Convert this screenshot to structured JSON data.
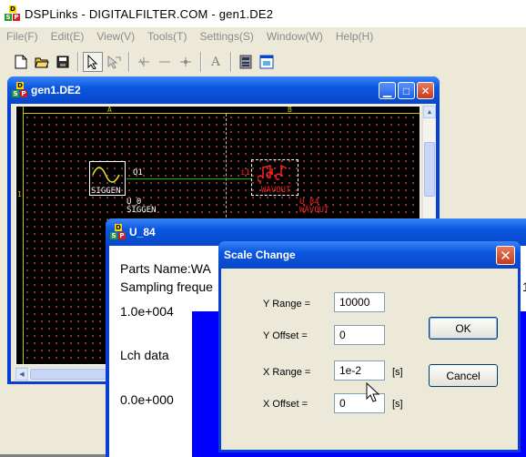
{
  "app": {
    "title": "DSPLinks - DIGITALFILTER.COM - gen1.DE2",
    "logo": {
      "d": "D",
      "s": "S",
      "p": "P"
    }
  },
  "menu": [
    "File(F)",
    "Edit(E)",
    "View(V)",
    "Tools(T)",
    "Settings(S)",
    "Window(W)",
    "Help(H)"
  ],
  "toolbar": {
    "buttons": [
      "new-file",
      "open-folder",
      "save",
      "select-arrow",
      "wire-tool",
      "component-tool",
      "line-tool",
      "junction-tool",
      "text-tool",
      "monitor",
      "window"
    ],
    "text_tool_glyph": "A"
  },
  "gen_window": {
    "title": "gen1.DE2",
    "columns": [
      "A",
      "B"
    ],
    "rows": [
      "1"
    ],
    "siggen": {
      "port": "O1",
      "name": "SIGGEN",
      "instance": "U_0",
      "type": "SIGGEN"
    },
    "wavout": {
      "port": "i1",
      "name": "WAVOUT",
      "instance": "U_84",
      "type": "WAVOUT"
    }
  },
  "u84_window": {
    "title": "U_84",
    "parts_name": "Parts Name:WA",
    "sampling": "Sampling freque",
    "y_max": "1.0e+004",
    "channel": "Lch data",
    "y_min": "0.0e+000",
    "right_fragment": "1"
  },
  "dialog": {
    "title": "Scale Change",
    "close_glyph": "✕",
    "fields": [
      {
        "label": "Y Range =",
        "value": "10000",
        "unit": ""
      },
      {
        "label": "Y Offset =",
        "value": "0",
        "unit": ""
      },
      {
        "label": "X Range =",
        "value": "1e-2",
        "unit": "[s]"
      },
      {
        "label": "X Offset =",
        "value": "0",
        "unit": "[s]"
      }
    ],
    "ok_label": "OK",
    "cancel_label": "Cancel"
  },
  "colors": {
    "titlebar_active": "#0b58e0",
    "schematic_bg": "#000000",
    "wire": "#00c000",
    "component_red": "#ff2020",
    "plot_bg": "#0000ff"
  }
}
